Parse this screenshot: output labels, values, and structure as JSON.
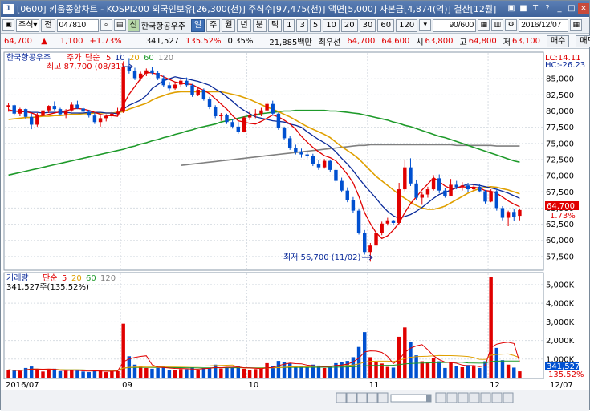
{
  "window": {
    "title": "[0600] 키움종합차트 - KOSPI200 외국인보유[26,300(천)] 주식수[97,475(천)] 액면[5,000] 자본금[4,874(억)] 결산[12월]",
    "titlebar_buttons": [
      "▣",
      "■",
      "T",
      "?",
      "_",
      "□",
      "×"
    ]
  },
  "toolbar": {
    "type_select": "주식",
    "prev_label": "전",
    "code": "047810",
    "credit_badge": "신",
    "stock_name": "한국항공우주",
    "period_tabs": [
      "일",
      "주",
      "월",
      "년",
      "분",
      "틱"
    ],
    "active_period": "일",
    "minute_tabs": [
      "1",
      "3",
      "5",
      "10",
      "20",
      "30",
      "60",
      "120"
    ],
    "count": "90/600",
    "date": "2016/12/07"
  },
  "infobar": {
    "price": "64,700",
    "change_symbol": "▲",
    "change": "1,100",
    "change_pct": "+1.73%",
    "volume": "341,527",
    "volume_ratio": "135.52%",
    "turnover": "0.35%",
    "amount": "21,885백만",
    "quote_label": "최우선",
    "ask": "64,700",
    "bid": "64,600",
    "open_label": "시",
    "open": "63,800",
    "high_label": "고",
    "high": "64,800",
    "low_label": "저",
    "low": "63,100",
    "buy_button": "매수",
    "sell_button": "매도"
  },
  "icons": {
    "app": "app-icon",
    "search": "search-icon",
    "settings": "gear-icon",
    "calendar": "calendar-icon"
  },
  "colors": {
    "up": "#e00000",
    "down": "#0050d0",
    "ma5": "#e00000",
    "ma10": "#0a2a9a",
    "ma20": "#e0a000",
    "ma60": "#1e9a2a",
    "ma120": "#808080"
  },
  "chart_data": [
    {
      "type": "candlestick",
      "legend": {
        "name": "한국항공우주",
        "indicator": "주가",
        "ma_label": "단순",
        "periods": [
          "5",
          "10",
          "20",
          "60",
          "120"
        ]
      },
      "yaxis": {
        "ticks": [
          "85,000",
          "82,500",
          "80,000",
          "77,500",
          "75,000",
          "72,500",
          "70,000",
          "67,500",
          "65,000",
          "62,500",
          "60,000",
          "57,500"
        ],
        "ylim": [
          55500,
          89000
        ],
        "top_labels": [
          "LC:14.11",
          "HC:-26.23"
        ],
        "last_price": "64,700",
        "last_pct": "1.73%"
      },
      "annotations": {
        "high": "최고 87,700 (08/31)",
        "low": "최저 56,700 (11/02)"
      },
      "candles": [
        [
          80600,
          81200,
          79900,
          80900
        ],
        [
          80900,
          81000,
          79300,
          79600
        ],
        [
          79600,
          80500,
          79200,
          80300
        ],
        [
          80300,
          80400,
          78800,
          79100
        ],
        [
          79100,
          79600,
          77200,
          77900
        ],
        [
          77900,
          79700,
          77600,
          79400
        ],
        [
          79400,
          80600,
          79100,
          80100
        ],
        [
          80100,
          80900,
          79700,
          80800
        ],
        [
          80800,
          81500,
          80100,
          80300
        ],
        [
          80300,
          80500,
          79300,
          79500
        ],
        [
          79500,
          80300,
          78900,
          80100
        ],
        [
          80100,
          81400,
          79900,
          81000
        ],
        [
          81000,
          81600,
          80300,
          80400
        ],
        [
          80400,
          80700,
          79600,
          79900
        ],
        [
          79900,
          80200,
          79000,
          79300
        ],
        [
          79300,
          79800,
          78000,
          78300
        ],
        [
          78300,
          79300,
          77600,
          78900
        ],
        [
          78900,
          79500,
          78400,
          79200
        ],
        [
          79200,
          79900,
          78900,
          79600
        ],
        [
          79600,
          80500,
          79300,
          79900
        ],
        [
          79900,
          87700,
          79700,
          86900
        ],
        [
          86900,
          88200,
          85800,
          86200
        ],
        [
          86200,
          86700,
          84800,
          85100
        ],
        [
          85100,
          86100,
          84700,
          85800
        ],
        [
          85800,
          86600,
          85400,
          86300
        ],
        [
          86300,
          86800,
          85700,
          85900
        ],
        [
          85900,
          86200,
          84800,
          85100
        ],
        [
          85100,
          85500,
          83700,
          84000
        ],
        [
          84000,
          84500,
          83200,
          83500
        ],
        [
          83500,
          84500,
          83300,
          84100
        ],
        [
          84100,
          85000,
          83700,
          84700
        ],
        [
          84700,
          85200,
          83700,
          84000
        ],
        [
          84000,
          84200,
          82200,
          82500
        ],
        [
          82500,
          83800,
          82300,
          83300
        ],
        [
          83300,
          83500,
          81600,
          81800
        ],
        [
          81800,
          82200,
          80300,
          80600
        ],
        [
          80600,
          80900,
          78900,
          79200
        ],
        [
          79200,
          79700,
          78500,
          79400
        ],
        [
          79400,
          79600,
          78000,
          78300
        ],
        [
          78300,
          78800,
          77300,
          77600
        ],
        [
          77600,
          78300,
          76500,
          76800
        ],
        [
          76800,
          79200,
          76700,
          79000
        ],
        [
          79000,
          79900,
          78600,
          79300
        ],
        [
          79300,
          80300,
          78900,
          79600
        ],
        [
          79600,
          80500,
          79200,
          80100
        ],
        [
          80100,
          81500,
          79900,
          81100
        ],
        [
          81100,
          81600,
          79300,
          79600
        ],
        [
          79600,
          79800,
          77100,
          77400
        ],
        [
          77400,
          77600,
          75500,
          75800
        ],
        [
          75800,
          76200,
          74000,
          74300
        ],
        [
          74300,
          74800,
          73300,
          73600
        ],
        [
          73600,
          74200,
          72800,
          73300
        ],
        [
          73300,
          73800,
          72700,
          73100
        ],
        [
          73100,
          73400,
          71500,
          71800
        ],
        [
          71800,
          72400,
          70900,
          71300
        ],
        [
          71300,
          72600,
          71100,
          72300
        ],
        [
          72300,
          72500,
          70600,
          70900
        ],
        [
          70900,
          71100,
          68900,
          69200
        ],
        [
          69200,
          69700,
          67400,
          67700
        ],
        [
          67700,
          68200,
          65900,
          66200
        ],
        [
          66200,
          66700,
          64300,
          64600
        ],
        [
          64600,
          64900,
          60900,
          61200
        ],
        [
          61200,
          61600,
          57800,
          58200
        ],
        [
          58200,
          59600,
          56700,
          59200
        ],
        [
          59200,
          61500,
          58800,
          61200
        ],
        [
          61200,
          62900,
          60800,
          62600
        ],
        [
          62600,
          63500,
          62300,
          63100
        ],
        [
          63100,
          63200,
          62400,
          62700
        ],
        [
          62700,
          68900,
          62500,
          67900
        ],
        [
          67900,
          72500,
          67600,
          71300
        ],
        [
          71300,
          72700,
          68400,
          68800
        ],
        [
          68800,
          69400,
          66300,
          66600
        ],
        [
          66600,
          67500,
          65500,
          67100
        ],
        [
          67100,
          68300,
          66600,
          67900
        ],
        [
          67900,
          70100,
          67700,
          69600
        ],
        [
          69600,
          70200,
          67300,
          67700
        ],
        [
          67700,
          68100,
          66600,
          66900
        ],
        [
          66900,
          69500,
          66800,
          68600
        ],
        [
          68600,
          69200,
          67900,
          68200
        ],
        [
          68200,
          69000,
          67700,
          68500
        ],
        [
          68500,
          68900,
          67500,
          67900
        ],
        [
          67900,
          68700,
          67700,
          68300
        ],
        [
          68300,
          68700,
          67400,
          67600
        ],
        [
          67600,
          67800,
          65700,
          66000
        ],
        [
          66000,
          67900,
          65900,
          67600
        ],
        [
          67600,
          68000,
          64600,
          65000
        ],
        [
          65000,
          65300,
          63100,
          63500
        ],
        [
          63500,
          64600,
          62200,
          64400
        ],
        [
          64400,
          64800,
          63000,
          63600
        ],
        [
          63800,
          64800,
          63100,
          64700
        ]
      ],
      "moving_averages": {
        "ma5": [
          80200,
          80000,
          79900,
          79900,
          79700,
          79400,
          79300,
          79500,
          79700,
          79900,
          80000,
          80300,
          80400,
          80300,
          80100,
          79800,
          79500,
          79300,
          79300,
          79200,
          81000,
          82600,
          83800,
          85000,
          86000,
          85900,
          85700,
          85300,
          84900,
          84500,
          84300,
          84200,
          84100,
          83600,
          83200,
          82700,
          81900,
          81100,
          80300,
          79300,
          78500,
          78300,
          78100,
          78000,
          78400,
          78900,
          79400,
          79100,
          78600,
          78000,
          77200,
          76100,
          75200,
          74400,
          73700,
          73100,
          72800,
          72300,
          71300,
          70200,
          68900,
          66800,
          64300,
          62600,
          61200,
          60300,
          60700,
          61600,
          62700,
          64300,
          65700,
          66700,
          67800,
          68700,
          69700,
          69100,
          68400,
          68000,
          68100,
          68300,
          68200,
          68200,
          68100,
          67700,
          67600,
          67300,
          66700,
          66100,
          65600,
          65200
        ],
        "ma10": [
          80000,
          80000,
          80000,
          79900,
          79800,
          79800,
          79700,
          79800,
          79800,
          79800,
          79800,
          79700,
          79700,
          79700,
          79800,
          79800,
          79800,
          79700,
          79700,
          79600,
          80300,
          80900,
          81300,
          81700,
          82400,
          83500,
          84100,
          84700,
          85000,
          85300,
          85100,
          85000,
          84800,
          84600,
          84300,
          84000,
          83400,
          82900,
          82200,
          81500,
          80700,
          80100,
          79600,
          79100,
          78900,
          78700,
          78500,
          78400,
          78300,
          78000,
          77800,
          77500,
          76800,
          76200,
          75600,
          75100,
          74500,
          73700,
          72700,
          71800,
          70800,
          69600,
          68500,
          67500,
          66500,
          65400,
          64500,
          63800,
          63400,
          63700,
          64000,
          64500,
          65100,
          65800,
          66500,
          67100,
          67400,
          67800,
          68100,
          68400,
          68700,
          68600,
          68500,
          68300,
          68100,
          67900,
          67600,
          67300,
          66900,
          66500
        ],
        "ma20": [
          78700,
          78800,
          78900,
          79000,
          79000,
          79100,
          79200,
          79200,
          79300,
          79300,
          79400,
          79500,
          79500,
          79600,
          79600,
          79700,
          79700,
          79700,
          79700,
          79800,
          79900,
          80300,
          80600,
          80900,
          81200,
          81700,
          82100,
          82400,
          82700,
          82900,
          83000,
          83000,
          83000,
          83000,
          83000,
          83000,
          83000,
          83000,
          82800,
          82600,
          82400,
          82100,
          81800,
          81400,
          81000,
          80600,
          80300,
          79900,
          79500,
          79100,
          78600,
          78100,
          77600,
          77200,
          76800,
          76400,
          75900,
          75200,
          74500,
          73900,
          73300,
          72600,
          71700,
          70800,
          69900,
          69200,
          68500,
          67800,
          67100,
          66500,
          65900,
          65400,
          65000,
          64800,
          64800,
          65000,
          65300,
          65800,
          66300,
          66800,
          67300,
          67700,
          68000,
          68200,
          68300,
          68200,
          68000,
          67800,
          67500,
          67200
        ],
        "ma60": [
          70100,
          70300,
          70500,
          70700,
          70900,
          71100,
          71300,
          71500,
          71700,
          71900,
          72100,
          72300,
          72500,
          72700,
          72900,
          73100,
          73300,
          73500,
          73700,
          73900,
          74100,
          74400,
          74600,
          74900,
          75100,
          75400,
          75600,
          75900,
          76100,
          76400,
          76600,
          76900,
          77100,
          77400,
          77600,
          77800,
          78000,
          78300,
          78500,
          78700,
          78900,
          79100,
          79300,
          79400,
          79600,
          79700,
          79800,
          79900,
          80000,
          80000,
          80100,
          80100,
          80100,
          80100,
          80100,
          80100,
          80000,
          80000,
          79900,
          79800,
          79700,
          79600,
          79400,
          79200,
          79000,
          78800,
          78600,
          78300,
          78100,
          77800,
          77600,
          77300,
          77000,
          76700,
          76400,
          76100,
          75900,
          75600,
          75300,
          75000,
          74700,
          74400,
          74100,
          73800,
          73500,
          73200,
          72900,
          72600,
          72300,
          72100
        ],
        "ma120": [
          null,
          null,
          null,
          null,
          null,
          null,
          null,
          null,
          null,
          null,
          null,
          null,
          null,
          null,
          null,
          null,
          null,
          null,
          null,
          null,
          null,
          null,
          null,
          null,
          null,
          null,
          null,
          null,
          null,
          null,
          71600,
          71700,
          71800,
          71900,
          72000,
          72100,
          72200,
          72300,
          72400,
          72500,
          72600,
          72700,
          72800,
          72900,
          73000,
          73100,
          73200,
          73300,
          73400,
          73500,
          73600,
          73700,
          73800,
          73900,
          74000,
          74100,
          74200,
          74300,
          74400,
          74500,
          74600,
          74700,
          74700,
          74800,
          74800,
          74800,
          74800,
          74800,
          74800,
          74800,
          74800,
          74800,
          74800,
          74800,
          74800,
          74800,
          74800,
          74800,
          74700,
          74700,
          74700,
          74700,
          74700,
          74700,
          74700,
          74600,
          74600,
          74600,
          74600,
          74600
        ]
      }
    },
    {
      "type": "bar",
      "legend": {
        "name": "거래량",
        "ma_label": "단순",
        "periods": [
          "5",
          "20",
          "60",
          "120"
        ],
        "current": "341,527주(135.52%)"
      },
      "yaxis": {
        "ticks": [
          "5,000K",
          "4,000K",
          "3,000K",
          "2,000K",
          "1,000K"
        ],
        "ylim": [
          0,
          5600
        ],
        "last_value": "341,527",
        "last_pct": "135.52%"
      },
      "volumes": [
        420,
        380,
        360,
        520,
        600,
        450,
        330,
        400,
        480,
        350,
        360,
        420,
        380,
        330,
        300,
        410,
        380,
        300,
        330,
        350,
        2900,
        1150,
        700,
        600,
        520,
        480,
        520,
        640,
        430,
        400,
        460,
        450,
        560,
        420,
        520,
        540,
        700,
        490,
        540,
        560,
        600,
        480,
        420,
        460,
        480,
        780,
        620,
        900,
        840,
        780,
        620,
        580,
        540,
        700,
        650,
        520,
        620,
        780,
        820,
        900,
        1100,
        1650,
        2450,
        1100,
        820,
        760,
        580,
        540,
        2200,
        2700,
        1900,
        1200,
        880,
        840,
        1050,
        880,
        520,
        800,
        620,
        560,
        680,
        600,
        520,
        880,
        5400,
        1600,
        940,
        700,
        540,
        341
      ]
    },
    {
      "type": "xaxis",
      "labels": [
        "2016/07",
        "09",
        "10",
        "11",
        "12",
        "12/07"
      ]
    }
  ]
}
